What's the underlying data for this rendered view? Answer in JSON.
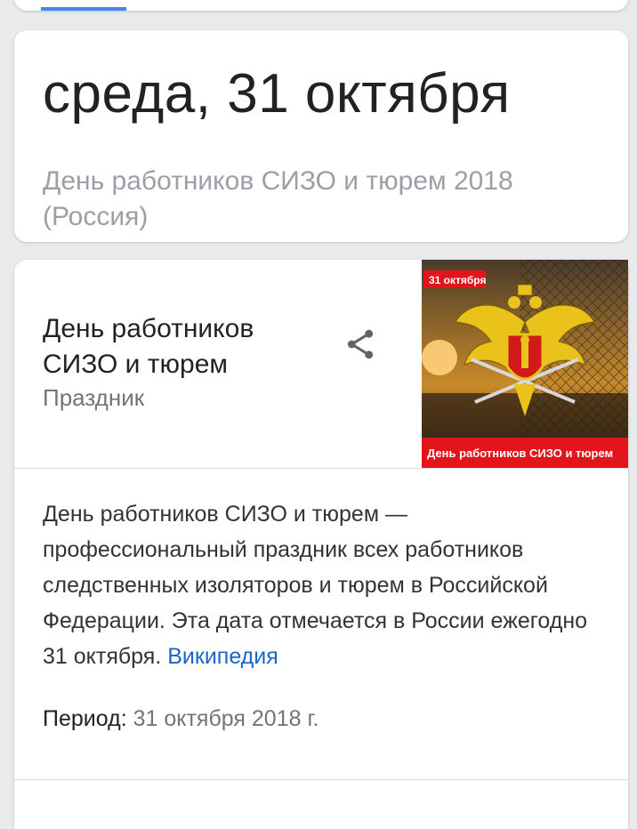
{
  "date_card": {
    "heading": "среда, 31 октября",
    "subtitle": "День работников СИЗО и тюрем 2018 (Россия)"
  },
  "knowledge_panel": {
    "title": "День работников СИЗО и тюрем",
    "type": "Праздник",
    "image": {
      "caption_top": "31 октября",
      "caption_bottom": "День работников СИЗО и тюрем",
      "banner_color": "#e3141b"
    },
    "description": "День работников СИЗО и тюрем — профессиональный праздник всех работников следственных изоляторов и тюрем в Российской Федерации. Эта дата отмечается в России ежегодно 31 октября.",
    "source_link": "Википедия",
    "period_label": "Период",
    "period_value": "31 октября 2018 г."
  },
  "colors": {
    "accent_blue": "#4285f4",
    "link": "#1a66c8",
    "muted_text": "#9aa0a6"
  },
  "icons": {
    "share": "share-icon",
    "emblem": "double-headed-eagle-emblem"
  }
}
